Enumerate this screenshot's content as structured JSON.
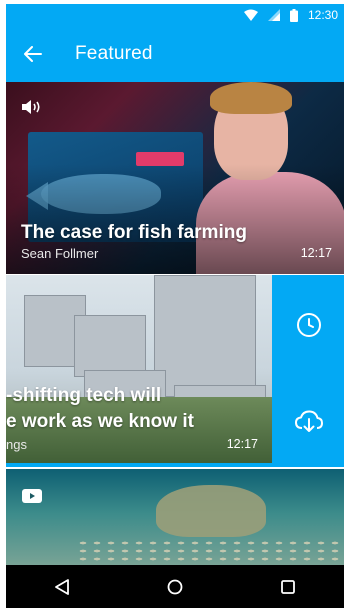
{
  "status_bar": {
    "time": "12:30"
  },
  "app_bar": {
    "title": "Featured",
    "back_icon": "arrow-back-icon"
  },
  "cards": [
    {
      "title": "The case for fish farming",
      "speaker": "Sean Follmer",
      "duration": "12:17",
      "badge_icon": "volume-icon"
    },
    {
      "title_line1": "-shifting tech will",
      "title_line2": "e work as we know it",
      "speaker": "ngs",
      "duration": "12:17",
      "actions": [
        "clock-icon",
        "cloud-download-icon"
      ]
    },
    {
      "badge_icon": "youtube-icon"
    }
  ],
  "nav_bar": {
    "buttons": [
      "back-triangle-icon",
      "home-circle-icon",
      "recents-square-icon"
    ]
  },
  "colors": {
    "accent": "#03A9F4"
  }
}
